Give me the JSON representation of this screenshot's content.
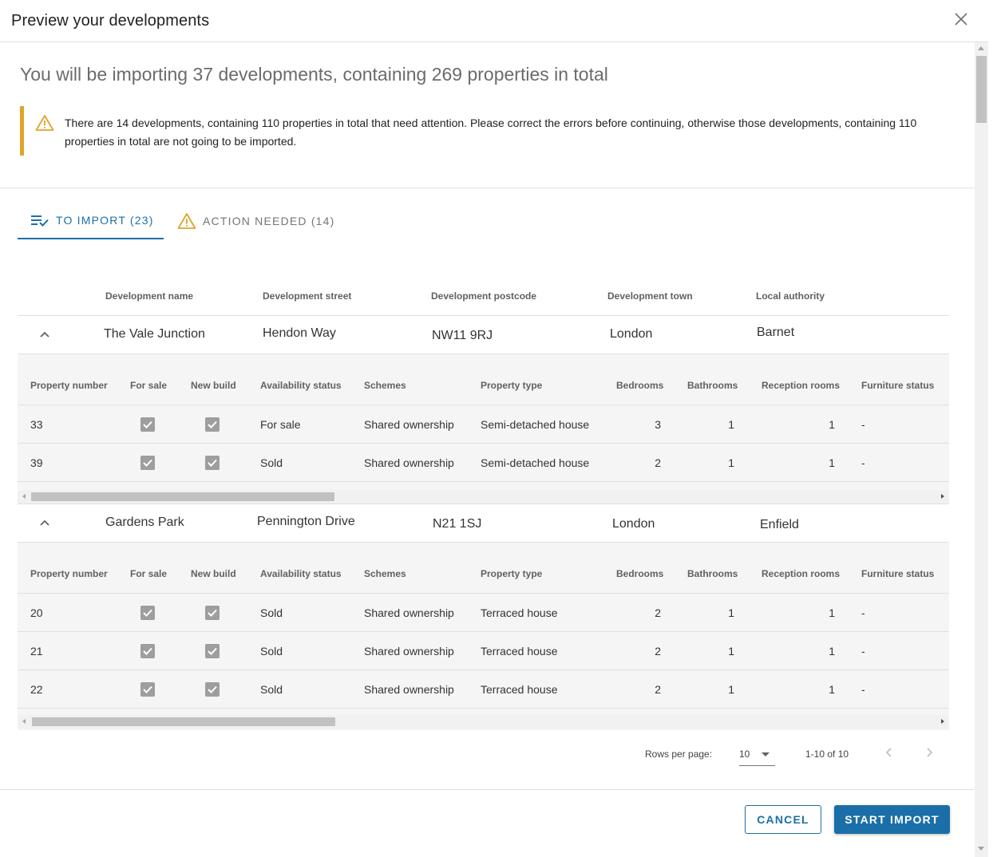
{
  "dialog": {
    "title": "Preview your developments",
    "summary": "You will be importing 37 developments, containing 269 properties in total",
    "alert_text": "There are 14 developments, containing 110 properties in total that need attention. Please correct the errors before continuing, otherwise those developments, containing 110 properties in total are not going to be imported."
  },
  "tabs": [
    {
      "label": "TO IMPORT (23)",
      "icon": "list-check-icon",
      "active": true
    },
    {
      "label": "ACTION NEEDED (14)",
      "icon": "warning-icon",
      "active": false
    }
  ],
  "dev_columns": [
    "Development name",
    "Development street",
    "Development postcode",
    "Development town",
    "Local authority"
  ],
  "prop_columns": [
    "Property number",
    "For sale",
    "New build",
    "Availability status",
    "Schemes",
    "Property type",
    "Bedrooms",
    "Bathrooms",
    "Reception rooms",
    "Furniture status"
  ],
  "developments": [
    {
      "name": "The Vale Junction",
      "street": "Hendon Way",
      "postcode": "NW11 9RJ",
      "town": "London",
      "authority": "Barnet",
      "properties": [
        {
          "number": "33",
          "for_sale": true,
          "new_build": true,
          "availability": "For sale",
          "scheme": "Shared ownership",
          "type": "Semi-detached house",
          "bedrooms": "3",
          "bathrooms": "1",
          "reception": "1",
          "furniture": "-"
        },
        {
          "number": "39",
          "for_sale": true,
          "new_build": true,
          "availability": "Sold",
          "scheme": "Shared ownership",
          "type": "Semi-detached house",
          "bedrooms": "2",
          "bathrooms": "1",
          "reception": "1",
          "furniture": "-"
        }
      ]
    },
    {
      "name": "Gardens Park",
      "street": "Pennington Drive",
      "postcode": "N21 1SJ",
      "town": "London",
      "authority": "Enfield",
      "properties": [
        {
          "number": "20",
          "for_sale": true,
          "new_build": true,
          "availability": "Sold",
          "scheme": "Shared ownership",
          "type": "Terraced house",
          "bedrooms": "2",
          "bathrooms": "1",
          "reception": "1",
          "furniture": "-"
        },
        {
          "number": "21",
          "for_sale": true,
          "new_build": true,
          "availability": "Sold",
          "scheme": "Shared ownership",
          "type": "Terraced house",
          "bedrooms": "2",
          "bathrooms": "1",
          "reception": "1",
          "furniture": "-"
        },
        {
          "number": "22",
          "for_sale": true,
          "new_build": true,
          "availability": "Sold",
          "scheme": "Shared ownership",
          "type": "Terraced house",
          "bedrooms": "2",
          "bathrooms": "1",
          "reception": "1",
          "furniture": "-"
        }
      ]
    }
  ],
  "pagination": {
    "rows_label": "Rows per page:",
    "rows_value": "10",
    "range": "1-10 of 10"
  },
  "footer": {
    "cancel_label": "CANCEL",
    "start_label": "START IMPORT"
  },
  "colors": {
    "primary": "#1b6fa8",
    "warning": "#e0a42a"
  }
}
